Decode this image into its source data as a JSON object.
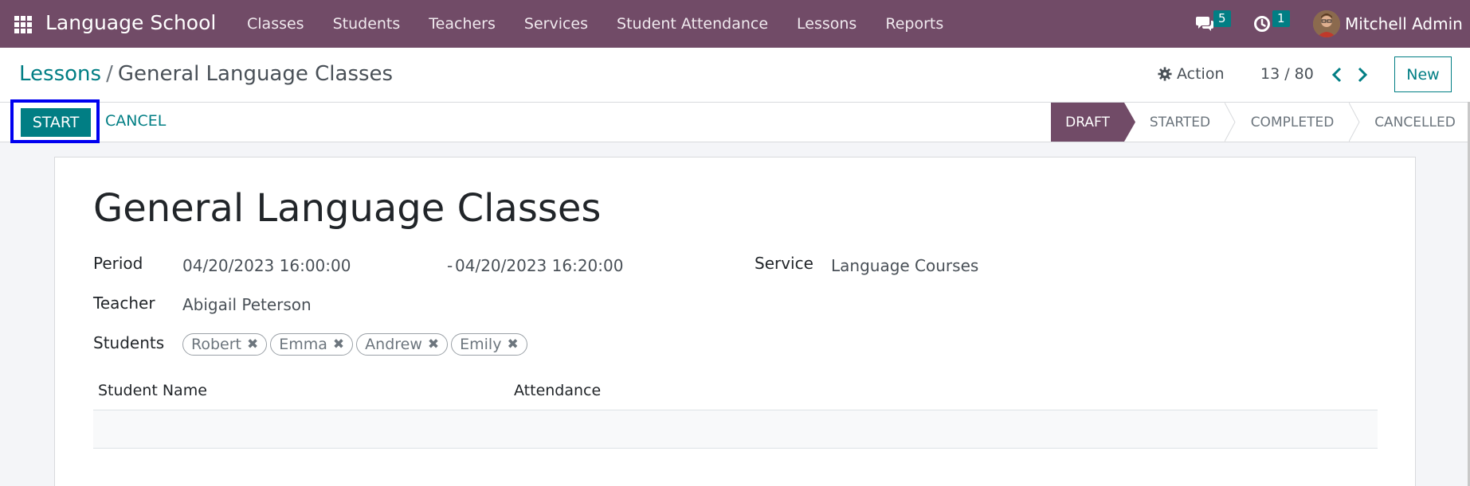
{
  "navbar": {
    "app_name": "Language School",
    "menu": [
      "Classes",
      "Students",
      "Teachers",
      "Services",
      "Student Attendance",
      "Lessons",
      "Reports"
    ],
    "messages_count": "5",
    "activities_count": "1",
    "user_name": "Mitchell Admin",
    "accent_color": "#714b67"
  },
  "control_panel": {
    "breadcrumb_parent": "Lessons",
    "breadcrumb_separator": "/",
    "breadcrumb_current": "General Language Classes",
    "action_label": "Action",
    "pager": "13 / 80",
    "new_label": "New"
  },
  "statusbar": {
    "start_label": "START",
    "cancel_label": "CANCEL",
    "stages": [
      "DRAFT",
      "STARTED",
      "COMPLETED",
      "CANCELLED"
    ],
    "active_stage": "DRAFT"
  },
  "form": {
    "title": "General Language Classes",
    "period_label": "Period",
    "period_start": "04/20/2023 16:00:00",
    "period_dash": "-",
    "period_end": "04/20/2023 16:20:00",
    "service_label": "Service",
    "service_value": "Language Courses",
    "teacher_label": "Teacher",
    "teacher_value": "Abigail Peterson",
    "students_label": "Students",
    "students": [
      "Robert",
      "Emma",
      "Andrew",
      "Emily"
    ],
    "table_columns": [
      "Student Name",
      "Attendance"
    ]
  }
}
